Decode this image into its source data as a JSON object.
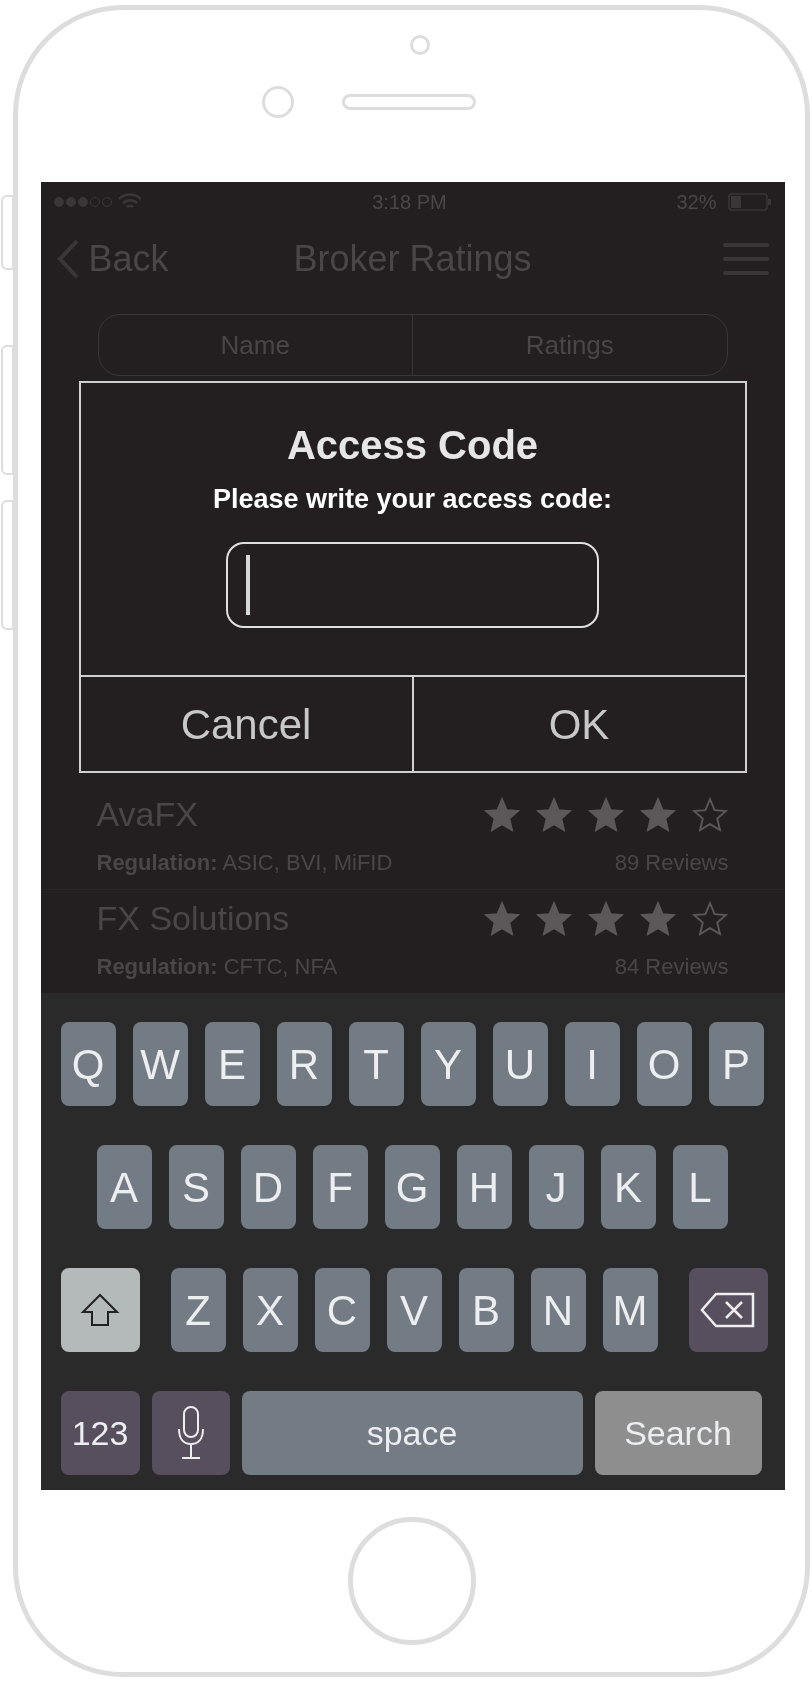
{
  "status_bar": {
    "time": "3:18 PM",
    "battery": "32%"
  },
  "nav": {
    "back": "Back",
    "title": "Broker Ratings"
  },
  "segments": [
    {
      "label": "Name",
      "selected": false
    },
    {
      "label": "Ratings",
      "selected": false
    }
  ],
  "brokers": [
    {
      "name": "AvaFX",
      "regulation_label": "Regulation:",
      "regulation": "ASIC,  BVI,  MiFID",
      "stars": 4,
      "reviews": "89 Reviews"
    },
    {
      "name": "FX  Solutions",
      "regulation_label": "Regulation:",
      "regulation": "CFTC,  NFA",
      "stars": 4,
      "reviews": "84 Reviews"
    }
  ],
  "dialog": {
    "title": "Access Code",
    "message": "Please write your access code:",
    "buttons": [
      "Cancel",
      "OK"
    ]
  },
  "keyboard": {
    "letter_rows": [
      [
        {
          "kind": "letter",
          "label": "Q"
        },
        {
          "kind": "letter",
          "label": "W"
        },
        {
          "kind": "letter",
          "label": "E"
        },
        {
          "kind": "letter",
          "label": "R"
        },
        {
          "kind": "letter",
          "label": "T"
        },
        {
          "kind": "letter",
          "label": "Y"
        },
        {
          "kind": "letter",
          "label": "U"
        },
        {
          "kind": "letter",
          "label": "I"
        },
        {
          "kind": "letter",
          "label": "O"
        },
        {
          "kind": "letter",
          "label": "P"
        }
      ],
      [
        {
          "kind": "letter",
          "label": "A"
        },
        {
          "kind": "letter",
          "label": "S"
        },
        {
          "kind": "letter",
          "label": "D"
        },
        {
          "kind": "letter",
          "label": "F"
        },
        {
          "kind": "letter",
          "label": "G"
        },
        {
          "kind": "letter",
          "label": "H"
        },
        {
          "kind": "letter",
          "label": "J"
        },
        {
          "kind": "letter",
          "label": "K"
        },
        {
          "kind": "letter",
          "label": "L"
        }
      ],
      [
        {
          "kind": "shift"
        },
        {
          "kind": "letter",
          "label": "Z"
        },
        {
          "kind": "letter",
          "label": "X"
        },
        {
          "kind": "letter",
          "label": "C"
        },
        {
          "kind": "letter",
          "label": "V"
        },
        {
          "kind": "letter",
          "label": "B"
        },
        {
          "kind": "letter",
          "label": "N"
        },
        {
          "kind": "letter",
          "label": "M"
        },
        {
          "kind": "delete"
        }
      ]
    ],
    "bottom_row": [
      {
        "kind": "numbers",
        "label": "123"
      },
      {
        "kind": "mic"
      },
      {
        "kind": "space",
        "label": "space"
      },
      {
        "kind": "action",
        "label": "Search"
      }
    ]
  }
}
